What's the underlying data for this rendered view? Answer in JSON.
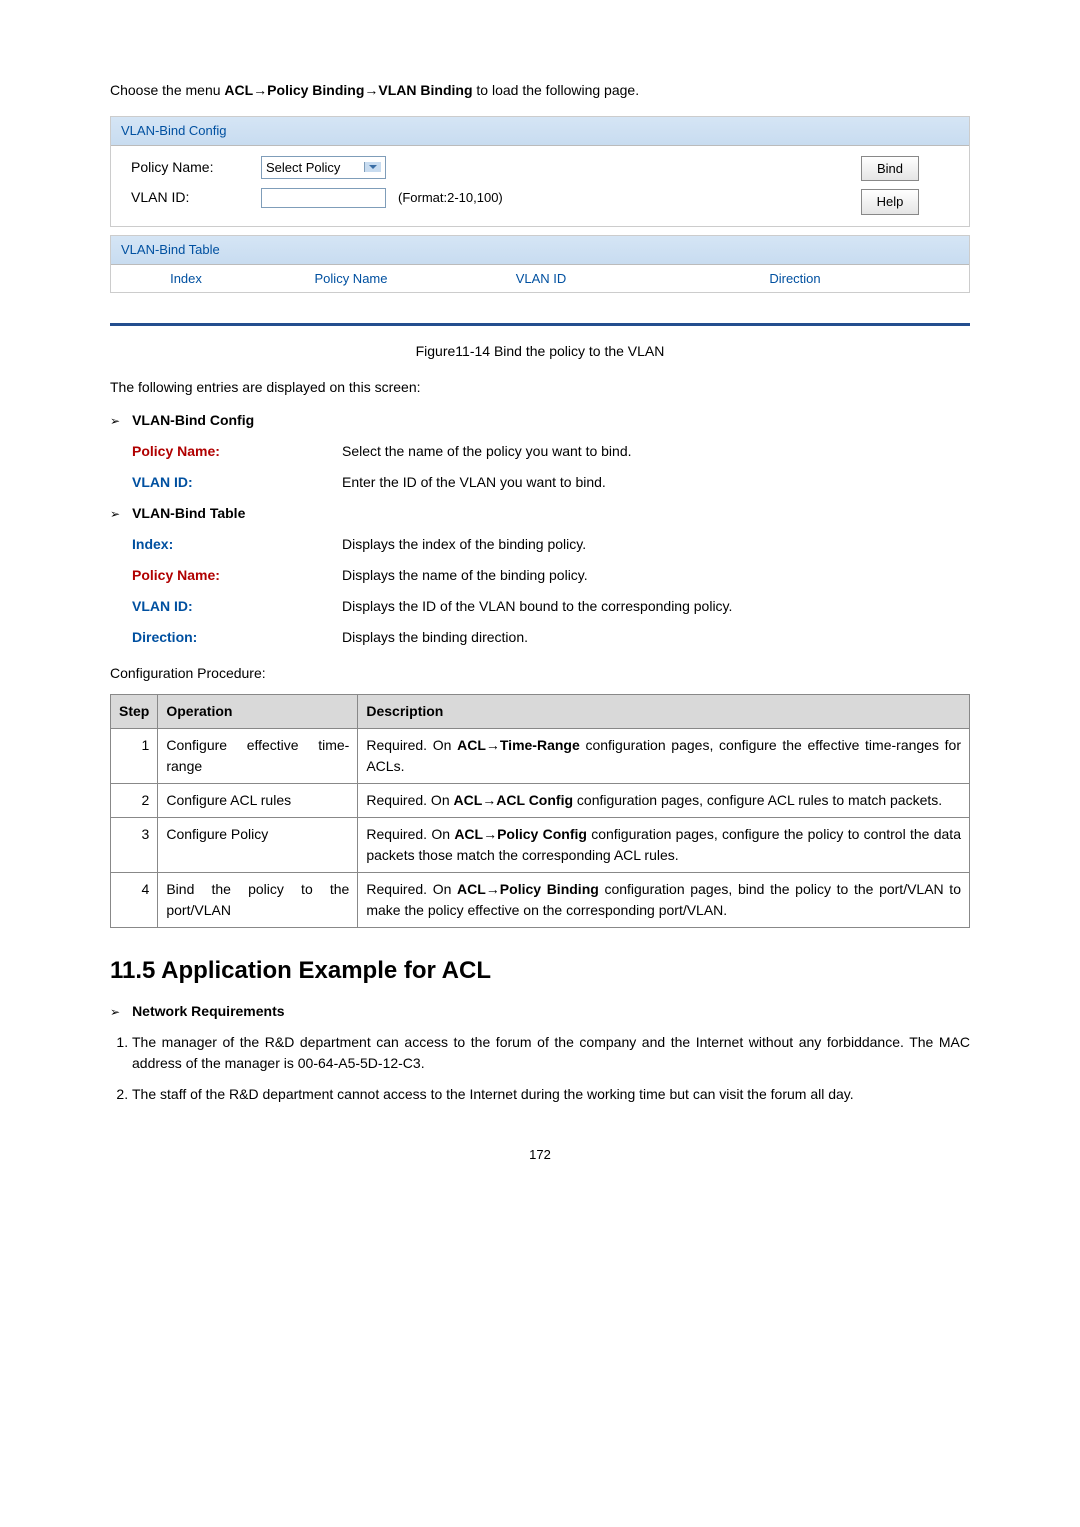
{
  "intro": {
    "prefix": "Choose the menu ",
    "path": "ACL→Policy Binding→VLAN Binding",
    "suffix": " to load the following page."
  },
  "config_panel": {
    "header": "VLAN-Bind Config",
    "policy_label": "Policy Name:",
    "policy_select": "Select Policy",
    "vlan_label": "VLAN ID:",
    "vlan_hint": "(Format:2-10,100)",
    "btn_bind": "Bind",
    "btn_help": "Help"
  },
  "table_panel": {
    "header": "VLAN-Bind Table",
    "col_index": "Index",
    "col_policy": "Policy Name",
    "col_vlan": "VLAN ID",
    "col_direction": "Direction"
  },
  "figure_caption": "Figure11-14 Bind the policy to the VLAN",
  "entries_intro": "The following entries are displayed on this screen:",
  "groups": [
    {
      "heading": "VLAN-Bind Config",
      "items": [
        {
          "term": "Policy Name:",
          "red": true,
          "desc": "Select the name of the policy you want to bind."
        },
        {
          "term": "VLAN ID:",
          "red": false,
          "desc": "Enter the ID of the VLAN you want to bind."
        }
      ]
    },
    {
      "heading": "VLAN-Bind Table",
      "items": [
        {
          "term": "Index:",
          "red": false,
          "desc": "Displays the index of the binding policy."
        },
        {
          "term": "Policy Name:",
          "red": true,
          "desc": "Displays the name of the binding policy."
        },
        {
          "term": "VLAN ID:",
          "red": false,
          "desc": "Displays the ID of the VLAN bound to the corresponding policy."
        },
        {
          "term": "Direction:",
          "red": false,
          "desc": "Displays the binding direction."
        }
      ]
    }
  ],
  "procedure_title": "Configuration Procedure:",
  "procedure_headers": {
    "step": "Step",
    "operation": "Operation",
    "description": "Description"
  },
  "procedure": [
    {
      "step": "1",
      "operation": "Configure effective time-range",
      "desc_prefix": "Required. On ",
      "desc_bold": "ACL→Time-Range",
      "desc_suffix": " configuration pages, configure the effective time-ranges for ACLs."
    },
    {
      "step": "2",
      "operation": "Configure ACL rules",
      "desc_prefix": "Required. On ",
      "desc_bold": "ACL→ACL Config",
      "desc_suffix": " configuration pages, configure ACL rules to match packets."
    },
    {
      "step": "3",
      "operation": "Configure Policy",
      "desc_prefix": "Required. On ",
      "desc_bold": "ACL→Policy Config",
      "desc_suffix": " configuration pages, configure the policy to control the data packets those match the corresponding ACL rules."
    },
    {
      "step": "4",
      "operation": "Bind the policy to the port/VLAN",
      "desc_prefix": "Required. On ",
      "desc_bold": "ACL→Policy Binding",
      "desc_suffix": " configuration pages, bind the policy to the port/VLAN to make the policy effective on the corresponding port/VLAN."
    }
  ],
  "app_heading": "11.5 Application Example for ACL",
  "network_req_heading": "Network Requirements",
  "requirements": [
    "The manager of the R&D department can access to the forum of the company and the Internet without any forbiddance. The MAC address of the manager is 00-64-A5-5D-12-C3.",
    "The staff of the R&D department cannot access to the Internet during the working time but can visit the forum all day."
  ],
  "page_number": "172"
}
